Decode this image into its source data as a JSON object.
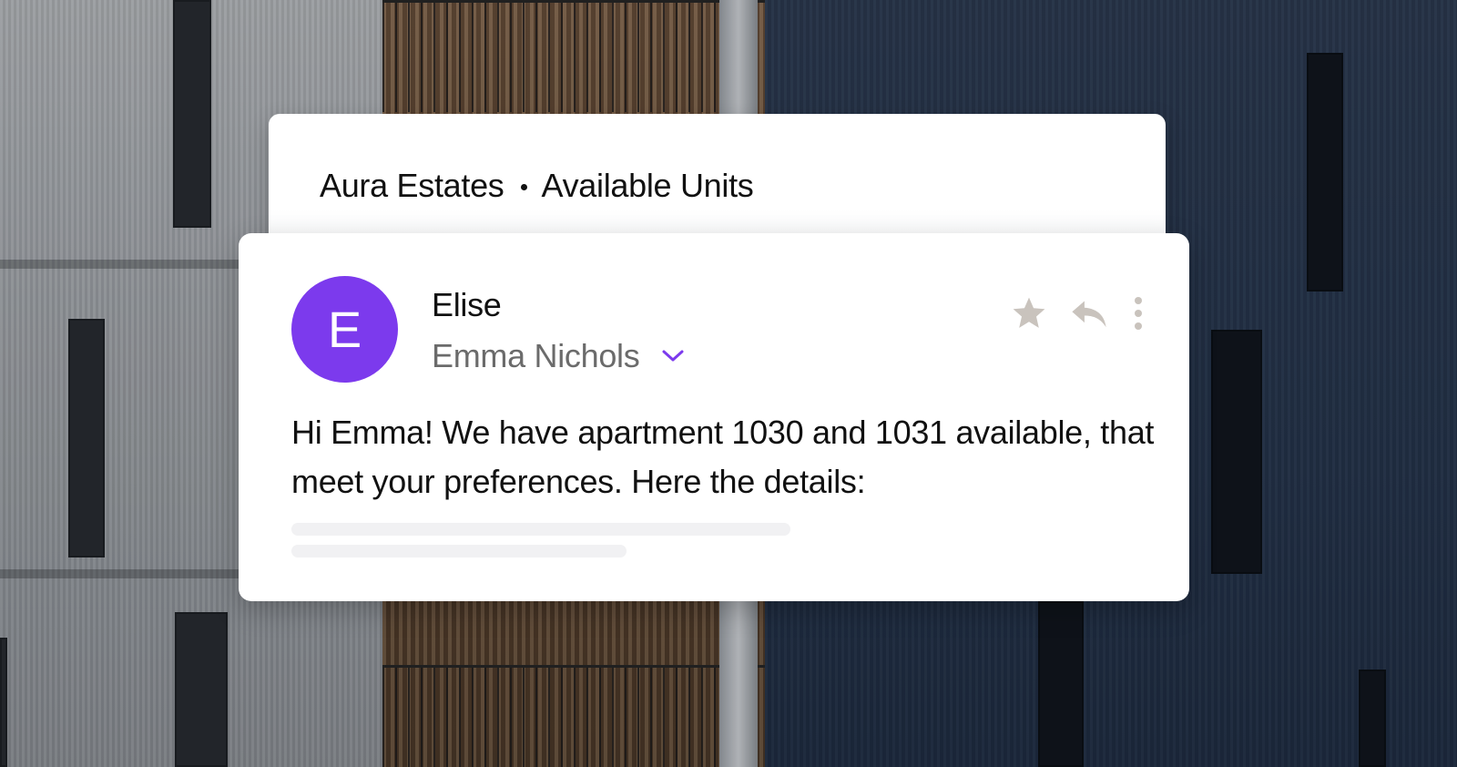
{
  "thread": {
    "organization": "Aura Estates",
    "subject": "Available Units"
  },
  "message": {
    "avatar_initial": "E",
    "sender_name": "Elise",
    "recipient_name": "Emma Nichols",
    "body": "Hi Emma! We have apartment 1030 and 1031 available, that meet your preferences. Here the details:"
  },
  "actions": {
    "star_icon": "star-icon",
    "reply_icon": "reply-icon",
    "more_icon": "more-vertical-icon",
    "expand_icon": "chevron-down-icon"
  },
  "colors": {
    "avatar": "#7c3aed",
    "chevron": "#7c3aed",
    "action_icons": "#c9c3bd",
    "skeleton": "#f1f1f3"
  }
}
